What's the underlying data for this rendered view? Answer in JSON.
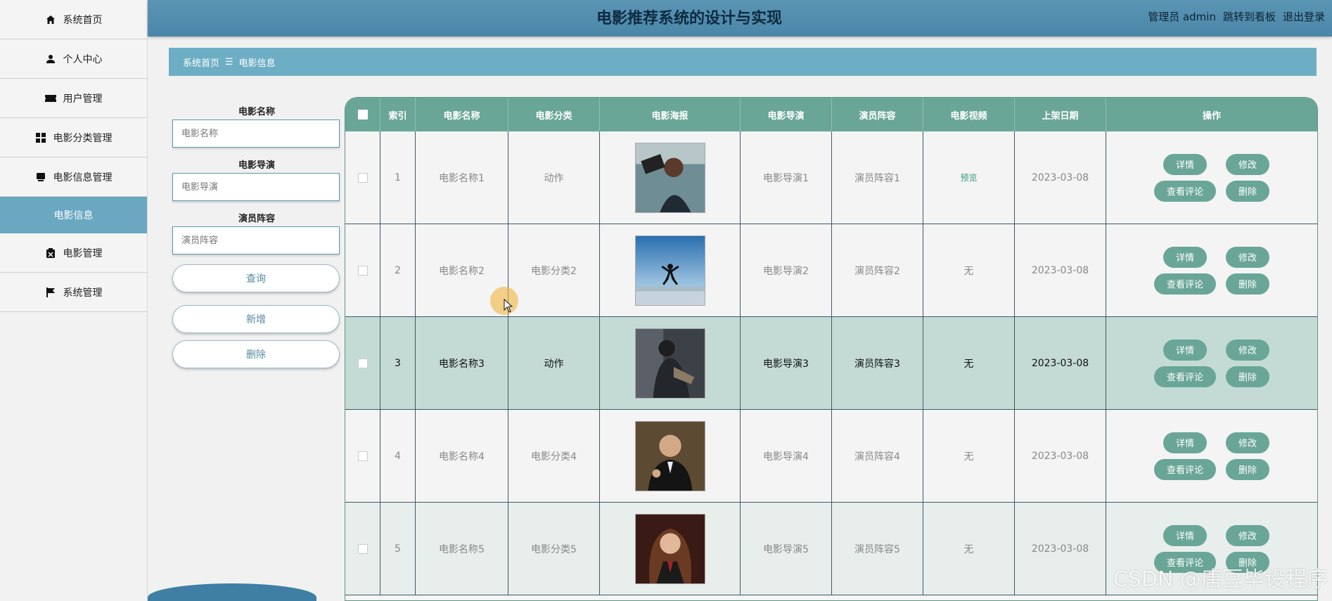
{
  "header": {
    "title": "电影推荐系统的设计与实现",
    "user": "管理员 admin",
    "board_link": "跳转到看板",
    "logout": "退出登录"
  },
  "sidebar": {
    "items": [
      {
        "label": "系统首页",
        "icon": "home-icon"
      },
      {
        "label": "个人中心",
        "icon": "person-icon"
      },
      {
        "label": "用户管理",
        "icon": "ticket-icon"
      },
      {
        "label": "电影分类管理",
        "icon": "grid-icon"
      },
      {
        "label": "电影信息管理",
        "icon": "monitor-icon"
      },
      {
        "label": "电影信息",
        "icon": ""
      },
      {
        "label": "电影管理",
        "icon": "clipboard-icon"
      },
      {
        "label": "系统管理",
        "icon": "flag-icon"
      }
    ]
  },
  "breadcrumb": {
    "home": "系统首页",
    "sep": "☰",
    "current": "电影信息"
  },
  "search": {
    "name_label": "电影名称",
    "name_placeholder": "电影名称",
    "director_label": "电影导演",
    "director_placeholder": "电影导演",
    "cast_label": "演员阵容",
    "cast_placeholder": "演员阵容",
    "query_btn": "查询",
    "add_btn": "新增",
    "delete_btn": "删除"
  },
  "table": {
    "columns": [
      "",
      "索引",
      "电影名称",
      "电影分类",
      "电影海报",
      "电影导演",
      "演员阵容",
      "电影视频",
      "上架日期",
      "操作"
    ],
    "rows": [
      {
        "index": "1",
        "name": "电影名称1",
        "category": "动作",
        "director": "电影导演1",
        "cast": "演员阵容1",
        "video": "预览",
        "date": "2023-03-08"
      },
      {
        "index": "2",
        "name": "电影名称2",
        "category": "电影分类2",
        "director": "电影导演2",
        "cast": "演员阵容2",
        "video": "无",
        "date": "2023-03-08"
      },
      {
        "index": "3",
        "name": "电影名称3",
        "category": "动作",
        "director": "电影导演3",
        "cast": "演员阵容3",
        "video": "无",
        "date": "2023-03-08"
      },
      {
        "index": "4",
        "name": "电影名称4",
        "category": "电影分类4",
        "director": "电影导演4",
        "cast": "演员阵容4",
        "video": "无",
        "date": "2023-03-08"
      },
      {
        "index": "5",
        "name": "电影名称5",
        "category": "电影分类5",
        "director": "电影导演5",
        "cast": "演员阵容5",
        "video": "无",
        "date": "2023-03-08"
      }
    ],
    "ops": {
      "detail": "详情",
      "edit": "修改",
      "comments": "查看评论",
      "delete": "删除"
    }
  },
  "watermark": "CSDN @唐豆毕设程序",
  "colors": {
    "header": "#4a86a8",
    "accent": "#6aa697",
    "highlight_row": "#c4dbd5",
    "active_menu": "#6aa8c2"
  }
}
